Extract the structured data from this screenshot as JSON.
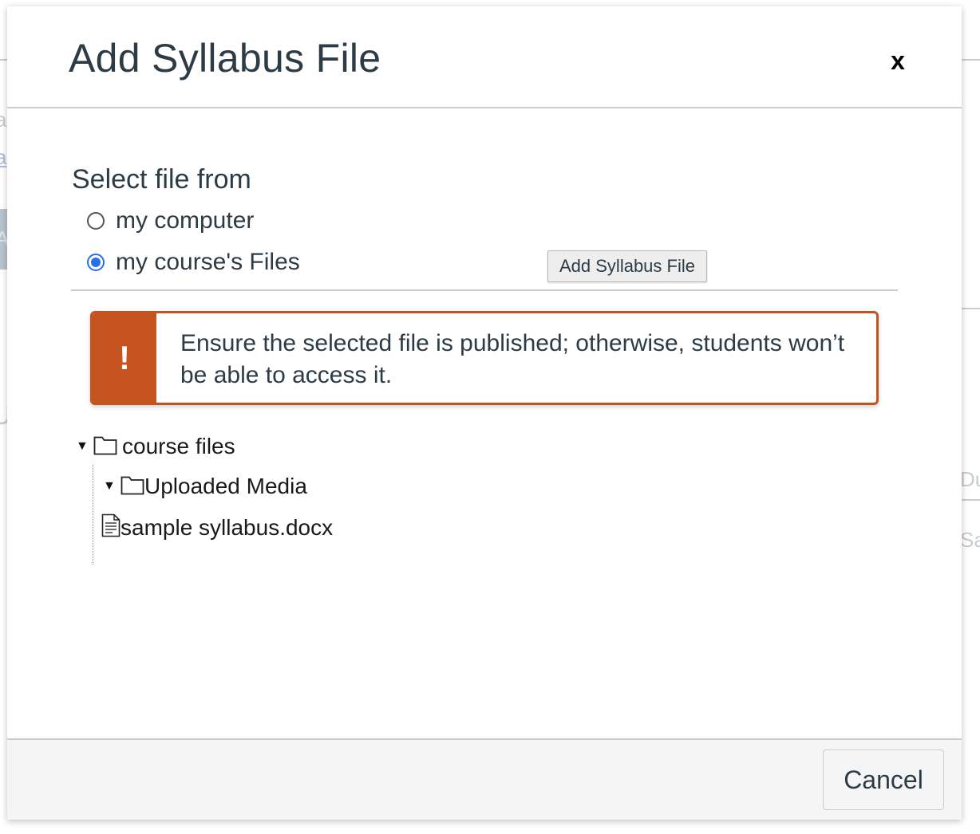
{
  "dialog": {
    "title": "Add Syllabus File",
    "close_label": "x"
  },
  "source": {
    "label": "Select file from",
    "options": [
      {
        "label": "my computer",
        "checked": false
      },
      {
        "label": "my course's Files",
        "checked": true
      }
    ]
  },
  "tooltip": "Add Syllabus File",
  "alert": {
    "icon": "!",
    "message": "Ensure the selected file is published; otherwise, students won’t be able to access it."
  },
  "tree": {
    "root": {
      "label": "course files",
      "expanded": true
    },
    "children": [
      {
        "label": "Uploaded Media",
        "type": "folder",
        "expanded": true
      },
      {
        "label": "sample syllabus.docx",
        "type": "file"
      }
    ]
  },
  "footer": {
    "cancel_label": "Cancel"
  },
  "background": {
    "fragments": [
      "a",
      "a",
      "A",
      "U",
      "Du",
      "Sa"
    ]
  },
  "colors": {
    "accent": "#2b6fe6",
    "warning": "#c4531f",
    "text": "#2d3b45",
    "divider": "#c7cdd1",
    "footer_bg": "#f5f5f5"
  }
}
